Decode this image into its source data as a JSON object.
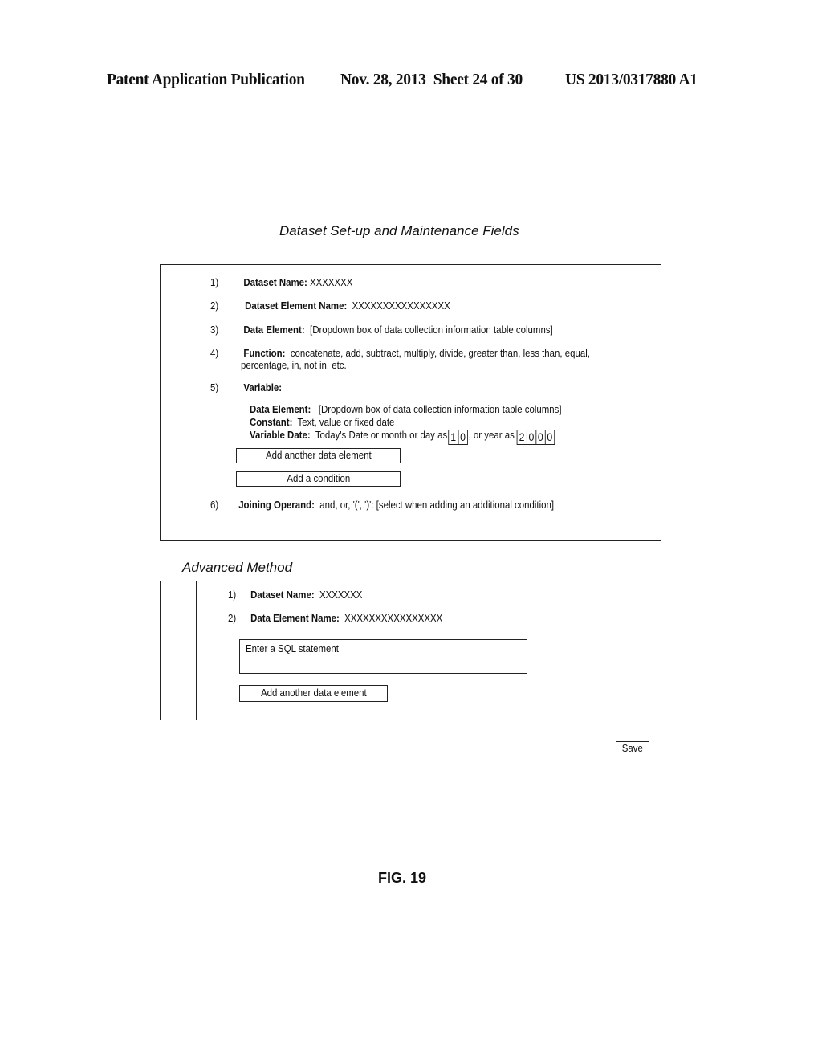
{
  "header": {
    "publication": "Patent Application Publication",
    "date_sheet": "Nov. 28, 2013  Sheet 24 of 30",
    "patent_number": "US 2013/0317880 A1"
  },
  "main_section": {
    "title": "Dataset Set-up and Maintenance Fields",
    "items": [
      {
        "num": "1)",
        "label": "Dataset Name:",
        "value": " XXXXXXX"
      },
      {
        "num": "2)",
        "label": "Dataset Element Name:",
        "value": "  XXXXXXXXXXXXXXXX"
      },
      {
        "num": "3)",
        "label": "Data Element:",
        "value": "  [Dropdown box of data collection information table columns]"
      },
      {
        "num": "4)",
        "label": "Function:",
        "value": "  concatenate, add, subtract, multiply, divide, greater than, less than, equal,",
        "value_line2": "percentage, in, not in, etc."
      },
      {
        "num": "5)",
        "label": "Variable:",
        "value": ""
      },
      {
        "num": "6)",
        "label": "Joining Operand:",
        "value": "  and, or, '(', ')': [select when adding an additional condition]"
      }
    ],
    "variable": {
      "data_element_label": "Data Element:",
      "data_element_value": "   [Dropdown box of data collection information table columns]",
      "constant_label": "Constant:",
      "constant_value": "  Text, value or fixed date",
      "variable_date_label": "Variable Date:",
      "variable_date_value": "  Today's Date or month or day as",
      "day_digits": [
        "1",
        "0"
      ],
      "year_text": ", or year as",
      "year_digits": [
        "2",
        "0",
        "0",
        "0"
      ]
    },
    "buttons": {
      "add_data_element": "Add another data element",
      "add_condition": "Add a condition"
    }
  },
  "advanced_section": {
    "title": "Advanced Method",
    "items": [
      {
        "num": "1)",
        "label": "Dataset Name:",
        "value": "  XXXXXXX"
      },
      {
        "num": "2)",
        "label": "Data Element Name:",
        "value": "  XXXXXXXXXXXXXXXX"
      }
    ],
    "sql_placeholder": "Enter a SQL statement",
    "add_data_element": "Add another data element"
  },
  "save_label": "Save",
  "figure_label": "FIG. 19"
}
